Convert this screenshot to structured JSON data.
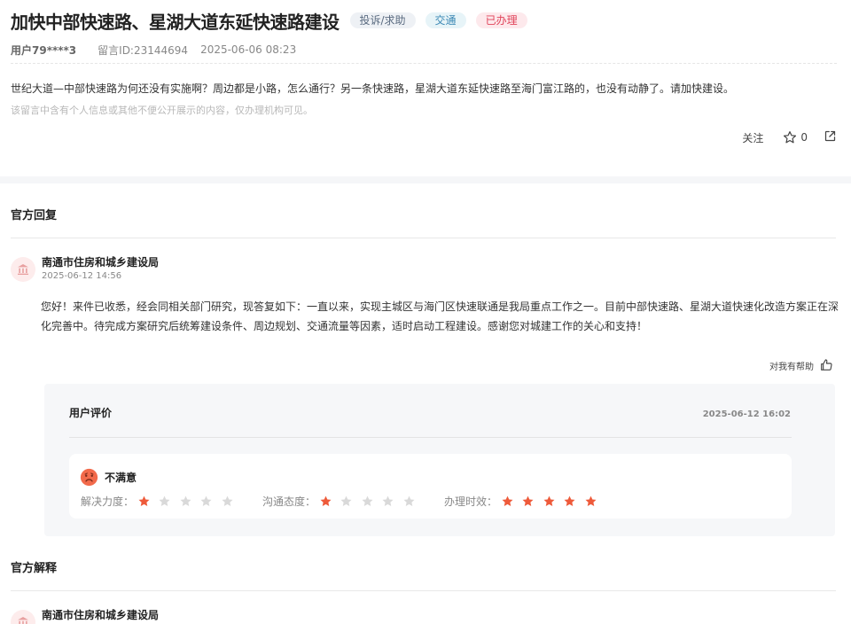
{
  "post": {
    "title": "加快中部快速路、星湖大道东延快速路建设",
    "tags": {
      "type": "投诉/求助",
      "category": "交通",
      "status": "已办理"
    },
    "user": "用户79****3",
    "message_id": "留言ID:23144694",
    "datetime": "2025-06-06 08:23",
    "content": "世纪大道—中部快速路为何还没有实施啊？周边都是小路，怎么通行？另一条快速路，星湖大道东延快速路至海门富江路的，也没有动静了。请加快建设。",
    "privacy_note": "该留言中含有个人信息或其他不便公开展示的内容，仅办理机构可见。",
    "follow_label": "关注",
    "favorite_count": "0"
  },
  "official_reply": {
    "section_title": "官方回复",
    "org_name": "南通市住房和城乡建设局",
    "time": "2025-06-12 14:56",
    "content": "您好！来件已收悉，经会同相关部门研究，现答复如下：一直以来，实现主城区与海门区快速联通是我局重点工作之一。目前中部快速路、星湖大道快速化改造方案正在深化完善中。待完成方案研究后统筹建设条件、周边规划、交通流量等因素，适时启动工程建设。感谢您对城建工作的关心和支持！",
    "helpful_label": "对我有帮助"
  },
  "evaluation": {
    "title": "用户评价",
    "time": "2025-06-12 16:02",
    "mood": "不满意",
    "ratings": [
      {
        "label": "解决力度：",
        "value": 1,
        "max": 5
      },
      {
        "label": "沟通态度：",
        "value": 1,
        "max": 5
      },
      {
        "label": "办理时效：",
        "value": 5,
        "max": 5
      }
    ]
  },
  "official_explanation": {
    "section_title": "官方解释",
    "org_name": "南通市住房和城乡建设局"
  },
  "colors": {
    "star_on": "#ee5a3a",
    "star_off": "#d9d9d9",
    "status": "#e0445a",
    "accent_blue": "#3a87b4"
  }
}
